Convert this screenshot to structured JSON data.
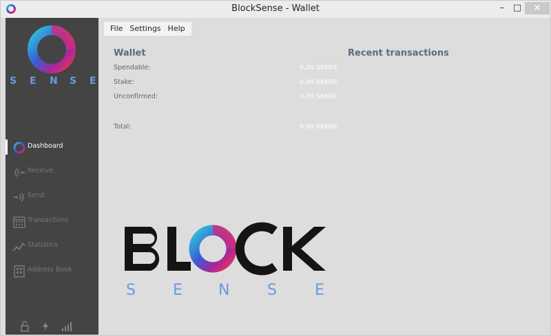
{
  "window": {
    "title": "BlockSense - Wallet",
    "minimize": "–",
    "maximize": "□",
    "close": "✕"
  },
  "brand": {
    "letters": [
      "S",
      "E",
      "N",
      "S",
      "E"
    ],
    "big_word": "BLOCK",
    "big_sub_letters": [
      "S",
      "E",
      "N",
      "S",
      "E"
    ]
  },
  "menu": [
    "File",
    "Settings",
    "Help"
  ],
  "nav": [
    {
      "label": "Dashboard",
      "icon": "logo-ring-icon",
      "active": true
    },
    {
      "label": "Receive",
      "icon": "receive-icon"
    },
    {
      "label": "Send",
      "icon": "send-icon"
    },
    {
      "label": "Transactions",
      "icon": "calendar-icon"
    },
    {
      "label": "Statistics",
      "icon": "chart-icon"
    },
    {
      "label": "Address Book",
      "icon": "address-book-icon"
    }
  ],
  "footer_icons": [
    "lock-icon",
    "lightning-icon",
    "signal-icon"
  ],
  "wallet": {
    "title": "Wallet",
    "rows": [
      {
        "label": "Spendable:",
        "value": "0.00 SENSE"
      },
      {
        "label": "Stake:",
        "value": "0.00 SENSE"
      },
      {
        "label": "Unconfirmed:",
        "value": "0.00 SENSE"
      },
      {
        "label": "Total:",
        "value": "0.00 SENSE"
      }
    ]
  },
  "recent": {
    "title": "Recent transactions"
  },
  "colors": {
    "sidebar": "#444444",
    "main": "#dddddd",
    "accent_blue": "#6a9ae0",
    "heading": "#5b6b84"
  }
}
